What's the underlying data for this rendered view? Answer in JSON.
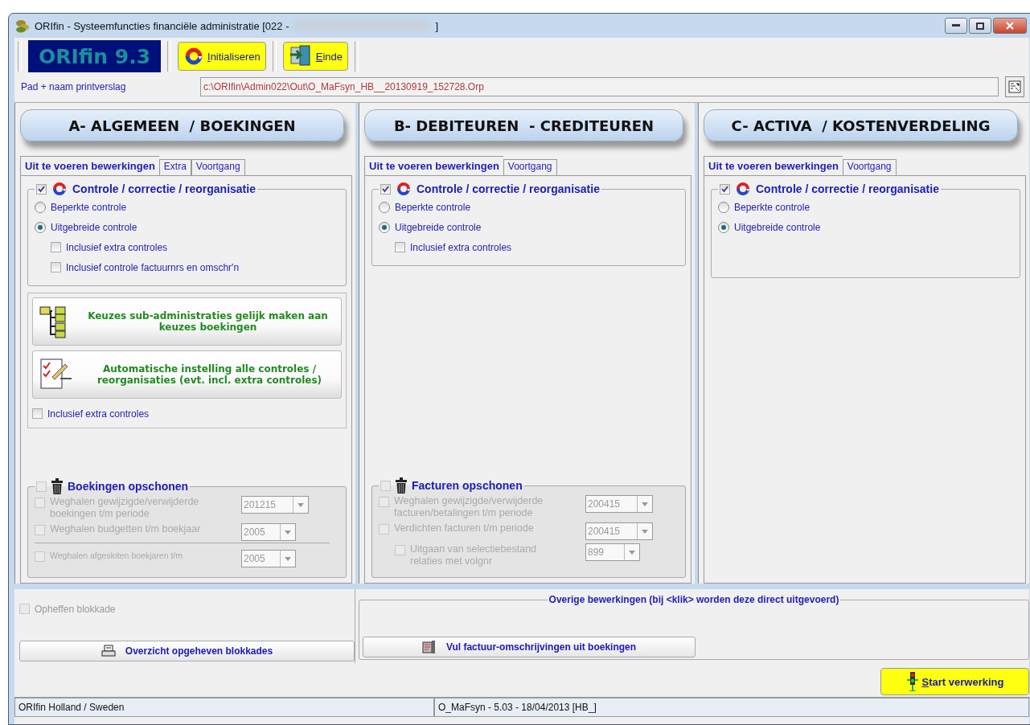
{
  "window": {
    "title": "ORIfin - Systeemfuncties financiële administratie [022 -",
    "title_end": "]"
  },
  "toolbar": {
    "logo": "ORIfin 9.3",
    "buttons": [
      {
        "label": "Initialiseren",
        "kind": "refresh"
      },
      {
        "label": "Einde",
        "kind": "exit"
      }
    ]
  },
  "print_path": {
    "label": "Pad + naam printverslag",
    "value": "c:\\ORIfin\\Admin022\\Out\\O_MaFsyn_HB__20130919_152728.Orp"
  },
  "panels": [
    {
      "heading": "A- ALGEMEEN  / BOEKINGEN",
      "tabs": [
        {
          "label": "Uit te voeren bewerkingen",
          "selected": true
        },
        {
          "label": "Extra",
          "selected": false
        },
        {
          "label": "Voortgang",
          "selected": false
        }
      ],
      "control_group": {
        "checked": true,
        "title": "Controle / correctie / reorganisatie",
        "options": [
          {
            "label": "Beperkte controle",
            "selected": false
          },
          {
            "label": "Uitgebreide controle",
            "selected": true
          }
        ],
        "sub_options": [
          {
            "label": "Inclusief extra controles",
            "checked": false
          },
          {
            "label": "Inclusief controle factuurnrs en omschr'n",
            "checked": false
          }
        ]
      },
      "actions": [
        {
          "label": "Keuzes sub-administraties gelijk maken aan keuzes boekingen",
          "kind": "tree"
        },
        {
          "label": "Automatische instelling alle controles / reorganisaties (evt. incl. extra controles)",
          "kind": "checklist"
        }
      ],
      "include_extra": {
        "label": "Inclusief extra controles",
        "checked": false
      },
      "cleanup": {
        "checked": false,
        "disabled": true,
        "title": "Boekingen opschonen",
        "rows": [
          {
            "kind": "main",
            "label": "Weghalen gewijzigde/verwijderde boekingen t/m periode",
            "value": "201215",
            "checked": false
          },
          {
            "kind": "main",
            "label": "Weghalen budgetten t/m boekjaar",
            "value": "2005",
            "checked": false
          },
          {
            "kind": "minor",
            "label": "Weghalen afgesloten boekjaren t/m",
            "value": "2005",
            "checked": false
          }
        ]
      }
    },
    {
      "heading": "B- DEBITEUREN  - CREDITEUREN",
      "tabs": [
        {
          "label": "Uit te voeren bewerkingen",
          "selected": true
        },
        {
          "label": "Voortgang",
          "selected": false
        }
      ],
      "control_group": {
        "checked": true,
        "title": "Controle / correctie / reorganisatie",
        "options": [
          {
            "label": "Beperkte controle",
            "selected": false
          },
          {
            "label": "Uitgebreide controle",
            "selected": true
          }
        ],
        "sub_options": [
          {
            "label": "Inclusief extra controles",
            "checked": false
          }
        ]
      },
      "cleanup": {
        "checked": false,
        "disabled": true,
        "title": "Facturen opschonen",
        "rows": [
          {
            "kind": "main",
            "label": "Weghalen gewijzigde/verwijderde facturen/betalingen t/m periode",
            "value": "200415",
            "checked": false
          },
          {
            "kind": "main",
            "label": "Verdichten facturen t/m periode",
            "value": "200415",
            "checked": false
          },
          {
            "kind": "nested",
            "label": "Uitgaan van selectiebestand relaties met volgnr",
            "value": "899",
            "checked": false
          }
        ]
      }
    },
    {
      "heading": "C- ACTIVA  / KOSTENVERDELING",
      "tabs": [
        {
          "label": "Uit te voeren bewerkingen",
          "selected": true
        },
        {
          "label": "Voortgang",
          "selected": false
        }
      ],
      "control_group": {
        "checked": true,
        "title": "Controle / correctie / reorganisatie",
        "options": [
          {
            "label": "Beperkte controle",
            "selected": false
          },
          {
            "label": "Uitgebreide controle",
            "selected": true
          }
        ]
      }
    }
  ],
  "unblock": {
    "label": "Opheffen blokkade",
    "checked": false,
    "disabled": true
  },
  "overview_button": "Overzicht opgeheven blokkades",
  "other_actions": {
    "title": "Overige bewerkingen (bij <klik> worden deze direct uitgevoerd)",
    "buttons": [
      "Vul factuur-omschrijvingen uit boekingen"
    ]
  },
  "start_button": "Start verwerking",
  "status_bar": [
    "ORIfin Holland / Sweden",
    "O_MaFsyn - 5.03 - 18/04/2013 [HB_]"
  ]
}
